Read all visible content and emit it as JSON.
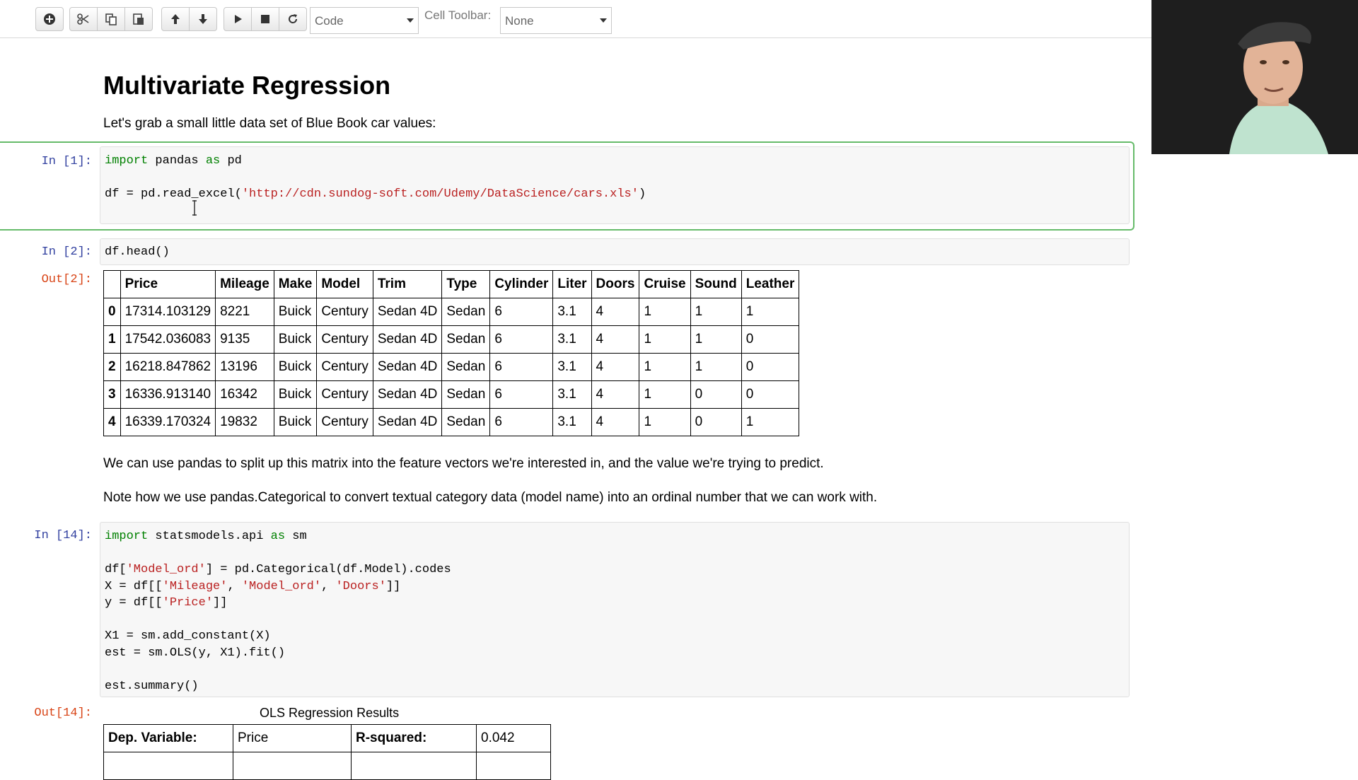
{
  "toolbar": {
    "cell_type": "Code",
    "cell_toolbar_label": "Cell Toolbar:",
    "cell_toolbar_value": "None"
  },
  "notebook": {
    "title": "Multivariate Regression",
    "intro": "Let's grab a small little data set of Blue Book car values:",
    "cell1": {
      "prompt": "In [1]:",
      "line1_kw_import": "import",
      "line1_a": " pandas ",
      "line1_kw_as": "as",
      "line1_b": " pd",
      "line2_a": "df = pd.read_excel(",
      "line2_str": "'http://cdn.sundog-soft.com/Udemy/DataScience/cars.xls'",
      "line2_b": ")"
    },
    "cell2": {
      "prompt": "In [2]:",
      "code": "df.head()",
      "out_prompt": "Out[2]:",
      "table": {
        "headers": [
          "",
          "Price",
          "Mileage",
          "Make",
          "Model",
          "Trim",
          "Type",
          "Cylinder",
          "Liter",
          "Doors",
          "Cruise",
          "Sound",
          "Leather"
        ],
        "rows": [
          [
            "0",
            "17314.103129",
            "8221",
            "Buick",
            "Century",
            "Sedan 4D",
            "Sedan",
            "6",
            "3.1",
            "4",
            "1",
            "1",
            "1"
          ],
          [
            "1",
            "17542.036083",
            "9135",
            "Buick",
            "Century",
            "Sedan 4D",
            "Sedan",
            "6",
            "3.1",
            "4",
            "1",
            "1",
            "0"
          ],
          [
            "2",
            "16218.847862",
            "13196",
            "Buick",
            "Century",
            "Sedan 4D",
            "Sedan",
            "6",
            "3.1",
            "4",
            "1",
            "1",
            "0"
          ],
          [
            "3",
            "16336.913140",
            "16342",
            "Buick",
            "Century",
            "Sedan 4D",
            "Sedan",
            "6",
            "3.1",
            "4",
            "1",
            "0",
            "0"
          ],
          [
            "4",
            "16339.170324",
            "19832",
            "Buick",
            "Century",
            "Sedan 4D",
            "Sedan",
            "6",
            "3.1",
            "4",
            "1",
            "0",
            "1"
          ]
        ]
      }
    },
    "md2": "We can use pandas to split up this matrix into the feature vectors we're interested in, and the value we're trying to predict.",
    "md3": "Note how we use pandas.Categorical to convert textual category data (model name) into an ordinal number that we can work with.",
    "cell3": {
      "prompt": "In [14]:",
      "l1_kw": "import",
      "l1_a": " statsmodels.api ",
      "l1_kw2": "as",
      "l1_b": " sm",
      "l3_a": "df[",
      "l3_s1": "'Model_ord'",
      "l3_b": "] = pd.Categorical(df.Model).codes",
      "l4_a": "X = df[[",
      "l4_s1": "'Mileage'",
      "l4_c1": ", ",
      "l4_s2": "'Model_ord'",
      "l4_c2": ", ",
      "l4_s3": "'Doors'",
      "l4_b": "]]",
      "l5_a": "y = df[[",
      "l5_s1": "'Price'",
      "l5_b": "]]",
      "l7": "X1 = sm.add_constant(X)",
      "l8": "est = sm.OLS(y, X1).fit()",
      "l10": "est.summary()",
      "out_prompt": "Out[14]:",
      "ols_title": "OLS Regression Results",
      "ols_row1": [
        "Dep. Variable:",
        "Price",
        "R-squared:",
        "0.042"
      ]
    }
  }
}
